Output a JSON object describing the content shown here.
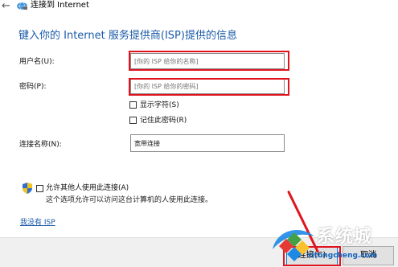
{
  "window": {
    "title": "连接到 Internet",
    "back_icon": "back-arrow-icon",
    "app_icon": "globe-network-icon"
  },
  "heading": "键入你的 Internet 服务提供商(ISP)提供的信息",
  "form": {
    "username_label": "用户名(U):",
    "username_placeholder": "[你的 ISP 给你的名称]",
    "password_label": "密码(P):",
    "password_placeholder": "[你的 ISP 给你的密码]",
    "show_chars_label": "显示字符(S)",
    "remember_password_label": "记住此密码(R)",
    "connection_name_label": "连接名称(N):",
    "connection_name_value": "宽带连接"
  },
  "share": {
    "shield_icon": "uac-shield-icon",
    "allow_others_label": "允许其他人使用此连接(A)",
    "description": "这个选项允许可以访问这台计算机的人使用此连接。"
  },
  "no_isp_link": "我没有 ISP",
  "footer": {
    "connect_label": "连接(C)",
    "cancel_label": "取消"
  },
  "watermark": {
    "text": "系统城",
    "url": "xitongcheng.com"
  },
  "colors": {
    "accent": "#1a5aa8",
    "highlight": "#e0141e"
  }
}
